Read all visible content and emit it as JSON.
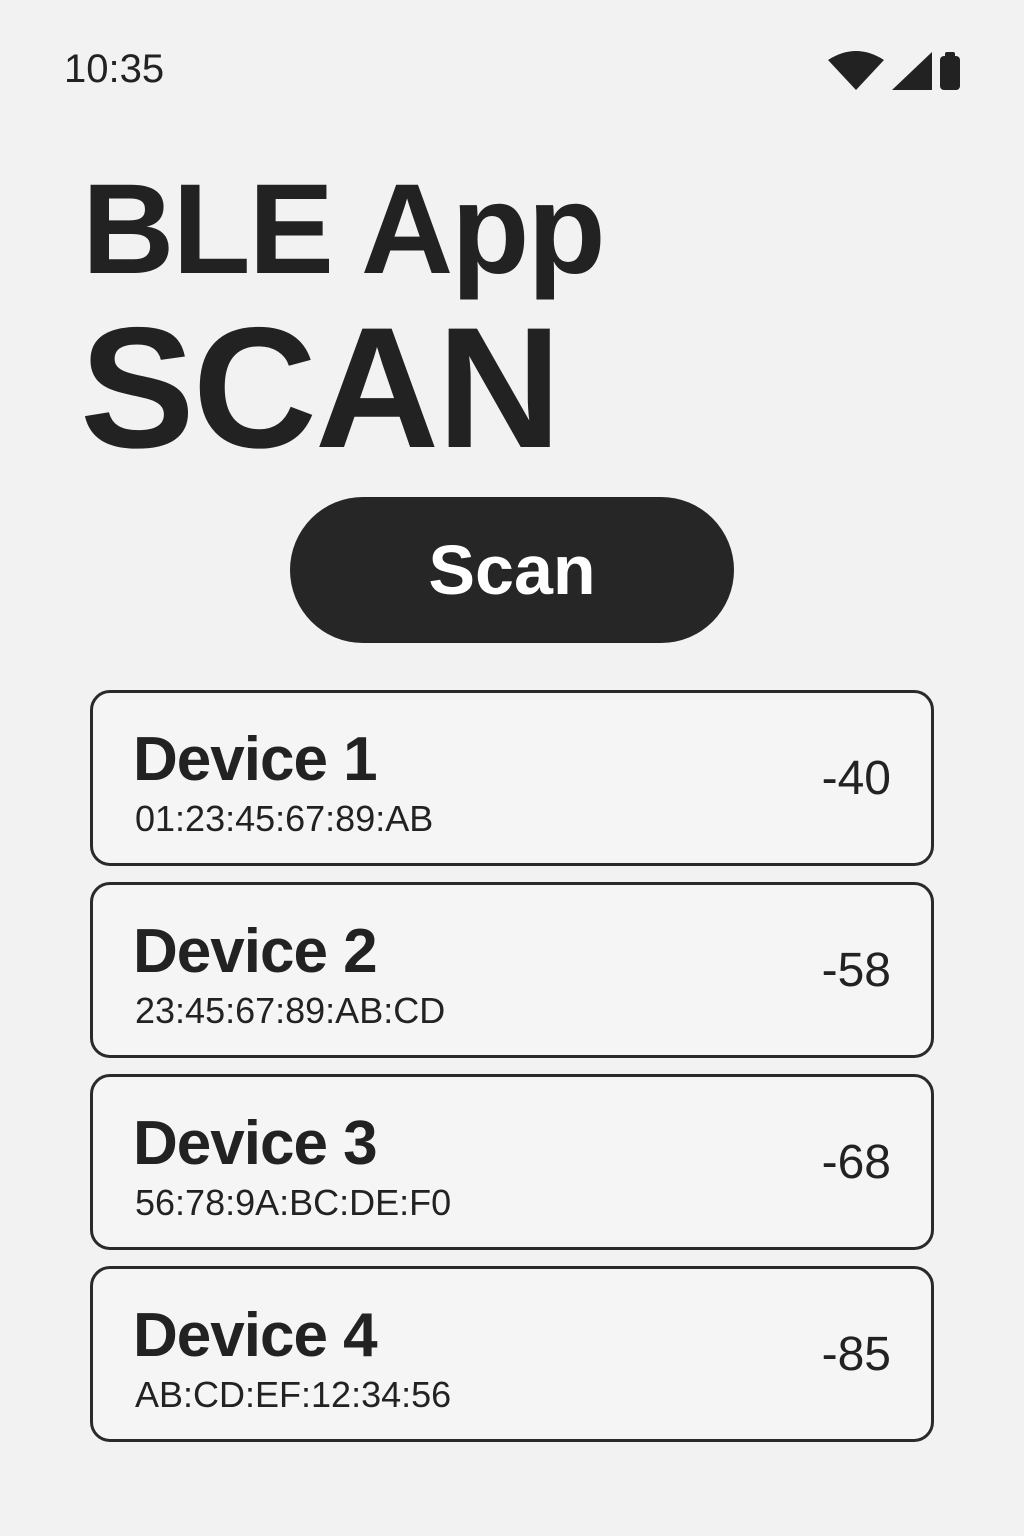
{
  "status_bar": {
    "time": "10:35",
    "icons": [
      "wifi-icon",
      "cellular-signal-icon",
      "battery-icon"
    ]
  },
  "header": {
    "app_title": "BLE App",
    "screen_title": "SCAN"
  },
  "scan_button": {
    "label": "Scan"
  },
  "devices": [
    {
      "name": "Device 1",
      "mac": "01:23:45:67:89:AB",
      "rssi": "-40"
    },
    {
      "name": "Device 2",
      "mac": "23:45:67:89:AB:CD",
      "rssi": "-58"
    },
    {
      "name": "Device 3",
      "mac": "56:78:9A:BC:DE:F0",
      "rssi": "-68"
    },
    {
      "name": "Device 4",
      "mac": "AB:CD:EF:12:34:56",
      "rssi": "-85"
    }
  ],
  "colors": {
    "background": "#f2f2f2",
    "text": "#222222",
    "button": "#262626",
    "button_text": "#ffffff"
  }
}
